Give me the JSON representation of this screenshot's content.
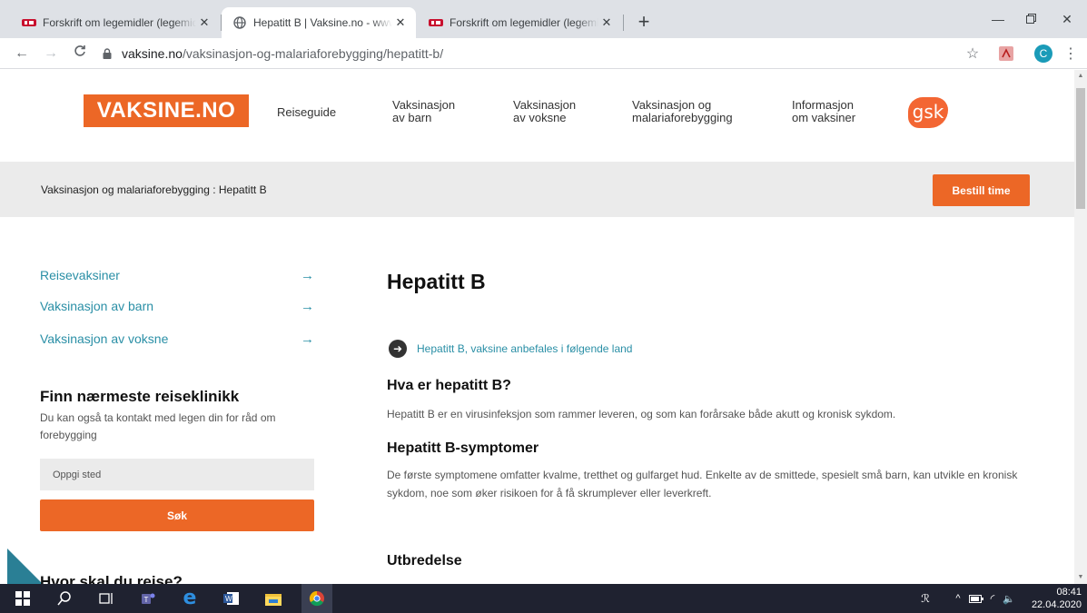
{
  "browser": {
    "tabs": [
      {
        "title": "Forskrift om legemidler (legemidl",
        "active": false
      },
      {
        "title": "Hepatitt B | Vaksine.no - www.vaksine.no",
        "active": true
      },
      {
        "title": "Forskrift om legemidler (legemidl",
        "active": false
      }
    ],
    "url_host": "vaksine.no",
    "url_path": "/vaksinasjon-og-malariaforebygging/hepatitt-b/",
    "profile_initial": "C"
  },
  "site": {
    "logo": "VAKSINE.NO",
    "brand_color": "#ec6726",
    "link_color": "#2a8fa6",
    "nav": [
      {
        "line1": "Reiseguide",
        "line2": ""
      },
      {
        "line1": "Vaksinasjon",
        "line2": "av barn"
      },
      {
        "line1": "Vaksinasjon",
        "line2": "av voksne"
      },
      {
        "line1": "Vaksinasjon og",
        "line2": "malariaforebygging"
      },
      {
        "line1": "Informasjon",
        "line2": "om vaksiner"
      }
    ],
    "partner_logo": "gsk",
    "breadcrumb": "Vaksinasjon og malariaforebygging : Hepatitt B",
    "book_button": "Bestill time"
  },
  "sidebar": {
    "links": [
      "Reisevaksiner",
      "Vaksinasjon av barn",
      "Vaksinasjon av voksne"
    ],
    "clinic_title": "Finn nærmeste reiseklinikk",
    "clinic_desc": "Du kan også ta kontakt med legen din for råd om forebygging",
    "place_placeholder": "Oppgi sted",
    "search_button": "Søk",
    "where_title": "Hvor skal du reise?"
  },
  "main": {
    "title": "Hepatitt B",
    "recommend_link": "Hepatitt B, vaksine anbefales i følgende land",
    "sections": [
      {
        "heading": "Hva er hepatitt B?",
        "text": "Hepatitt B er en virusinfeksjon som rammer leveren, og som kan forårsake både akutt og kronisk sykdom."
      },
      {
        "heading": "Hepatitt B-symptomer",
        "text": "De første symptomene omfatter kvalme, tretthet og gulfarget hud. Enkelte av de smittede, spesielt små barn, kan utvikle en kronisk sykdom, noe som øker risikoen for å få skrumplever eller leverkreft."
      },
      {
        "heading": "Utbredelse",
        "text": ""
      }
    ]
  },
  "taskbar": {
    "time": "08:41",
    "date": "22.04.2020"
  }
}
